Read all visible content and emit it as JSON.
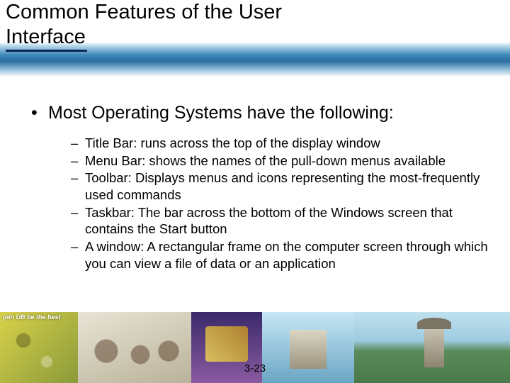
{
  "title": "Common Features of the User Interface",
  "main_bullet": "Most Operating Systems have the following:",
  "sub_items": [
    "Title Bar: runs across the top of the display window",
    "Menu Bar: shows the names of the pull-down menus available",
    "Toolbar: Displays menus and icons representing the most-frequently used commands",
    "Taskbar: The bar across the bottom of the Windows screen that contains the Start button",
    "A window: A rectangular frame on the computer screen through which you can view a file of data or an application"
  ],
  "join_tag": "join UB be the best",
  "page_number": "3-23"
}
